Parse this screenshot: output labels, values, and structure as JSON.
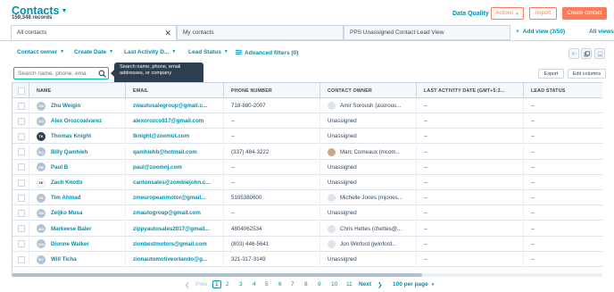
{
  "header": {
    "title": "Contacts",
    "record_count": "159,348 records",
    "data_quality": "Data Quality",
    "actions": "Actions",
    "import": "Import",
    "create_contact": "Create contact"
  },
  "tabs": [
    {
      "label": "All contacts",
      "closable": true
    },
    {
      "label": "My contacts"
    },
    {
      "label": "PPS Unassigned Contact Lead View"
    }
  ],
  "add_view": "Add view (3/50)",
  "all_views": "All views",
  "filters": [
    "Contact owner",
    "Create Date",
    "Last Activity D...",
    "Lead Status",
    "Advanced filters (0)"
  ],
  "search": {
    "placeholder": "Search name, phone, ema"
  },
  "tooltip": "Search name, phone, email addresses, or company",
  "table_actions": {
    "export": "Export",
    "edit_columns": "Edit columns"
  },
  "columns": [
    "NAME",
    "EMAIL",
    "PHONE NUMBER",
    "CONTACT OWNER",
    "LAST ACTIVITY DATE (GMT+5:3...",
    "LEAD STATUS"
  ],
  "rows": [
    {
      "initials": "ZW",
      "name": "Zhu Weigin",
      "email": "zwautosalegroup@gmail.c...",
      "phone": "718-880-2007",
      "owner": "Amir Soroush (asorous...",
      "owner_photo": false,
      "last_activity": "--",
      "lead_status": "--"
    },
    {
      "initials": "AO",
      "name": "Alex Orozcoalvarez",
      "email": "alexorozco817@gmail.com",
      "phone": "--",
      "owner": "Unassigned",
      "owner_photo": false,
      "last_activity": "--",
      "lead_status": "--"
    },
    {
      "initials": "TK",
      "name": "Thomas Knight",
      "email": "tknight@zoomut.com",
      "phone": "--",
      "owner": "Unassigned",
      "owner_photo": false,
      "last_activity": "--",
      "lead_status": "--"
    },
    {
      "initials": "BQ",
      "name": "Billy Qamhieh",
      "email": "qamhiehb@hotmail.com",
      "phone": "(337) 484-3222",
      "owner": "Marc Comeaux (mcom...",
      "owner_photo": true,
      "last_activity": "--",
      "lead_status": "--"
    },
    {
      "initials": "PB",
      "name": "Paul B",
      "email": "paul@zoomnj.com",
      "phone": "--",
      "owner": "Unassigned",
      "owner_photo": false,
      "last_activity": "--",
      "lead_status": "--"
    },
    {
      "initials": "ZK",
      "name": "Zach Knotts",
      "email": "cantonsales@zombiejohn.c...",
      "phone": "--",
      "owner": "Unassigned",
      "owner_photo": false,
      "last_activity": "--",
      "lead_status": "--"
    },
    {
      "initials": "TA",
      "name": "Tim Ahmad",
      "email": "zmeuropeanmotor@gmail...",
      "phone": "5105380600",
      "owner": "Michelle Jones (mjones...",
      "owner_photo": false,
      "last_activity": "--",
      "lead_status": "--"
    },
    {
      "initials": "ZM",
      "name": "Zeljko Musa",
      "email": "zmautogroup@gmail.com",
      "phone": "--",
      "owner": "Unassigned",
      "owner_photo": false,
      "last_activity": "--",
      "lead_status": "--"
    },
    {
      "initials": "MB",
      "name": "Markeese Baler",
      "email": "zippyautosales2017@gmail...",
      "phone": "4804062534",
      "owner": "Chris Hettes (chettes@...",
      "owner_photo": false,
      "last_activity": "--",
      "lead_status": "--"
    },
    {
      "initials": "DW",
      "name": "Dionne Walker",
      "email": "zionbestmotors@gmail.com",
      "phone": "(803) 446-5641",
      "owner": "Jon Winford (jwinford...",
      "owner_photo": false,
      "last_activity": "--",
      "lead_status": "--"
    },
    {
      "initials": "WT",
      "name": "Will Ticha",
      "email": "zionautomotiveorlando@g...",
      "phone": "321-317-3149",
      "owner": "Unassigned",
      "owner_photo": false,
      "last_activity": "--",
      "lead_status": "--"
    }
  ],
  "pagination": {
    "prev": "Prev",
    "pages": [
      "1",
      "2",
      "3",
      "4",
      "5",
      "6",
      "7",
      "8",
      "9",
      "10",
      "11"
    ],
    "current": "1",
    "next": "Next",
    "per_page": "100 per page"
  },
  "colors": {
    "accent": "#0091ae",
    "brand": "#ff7a59",
    "focus": "#00bda5",
    "text": "#33475b"
  }
}
